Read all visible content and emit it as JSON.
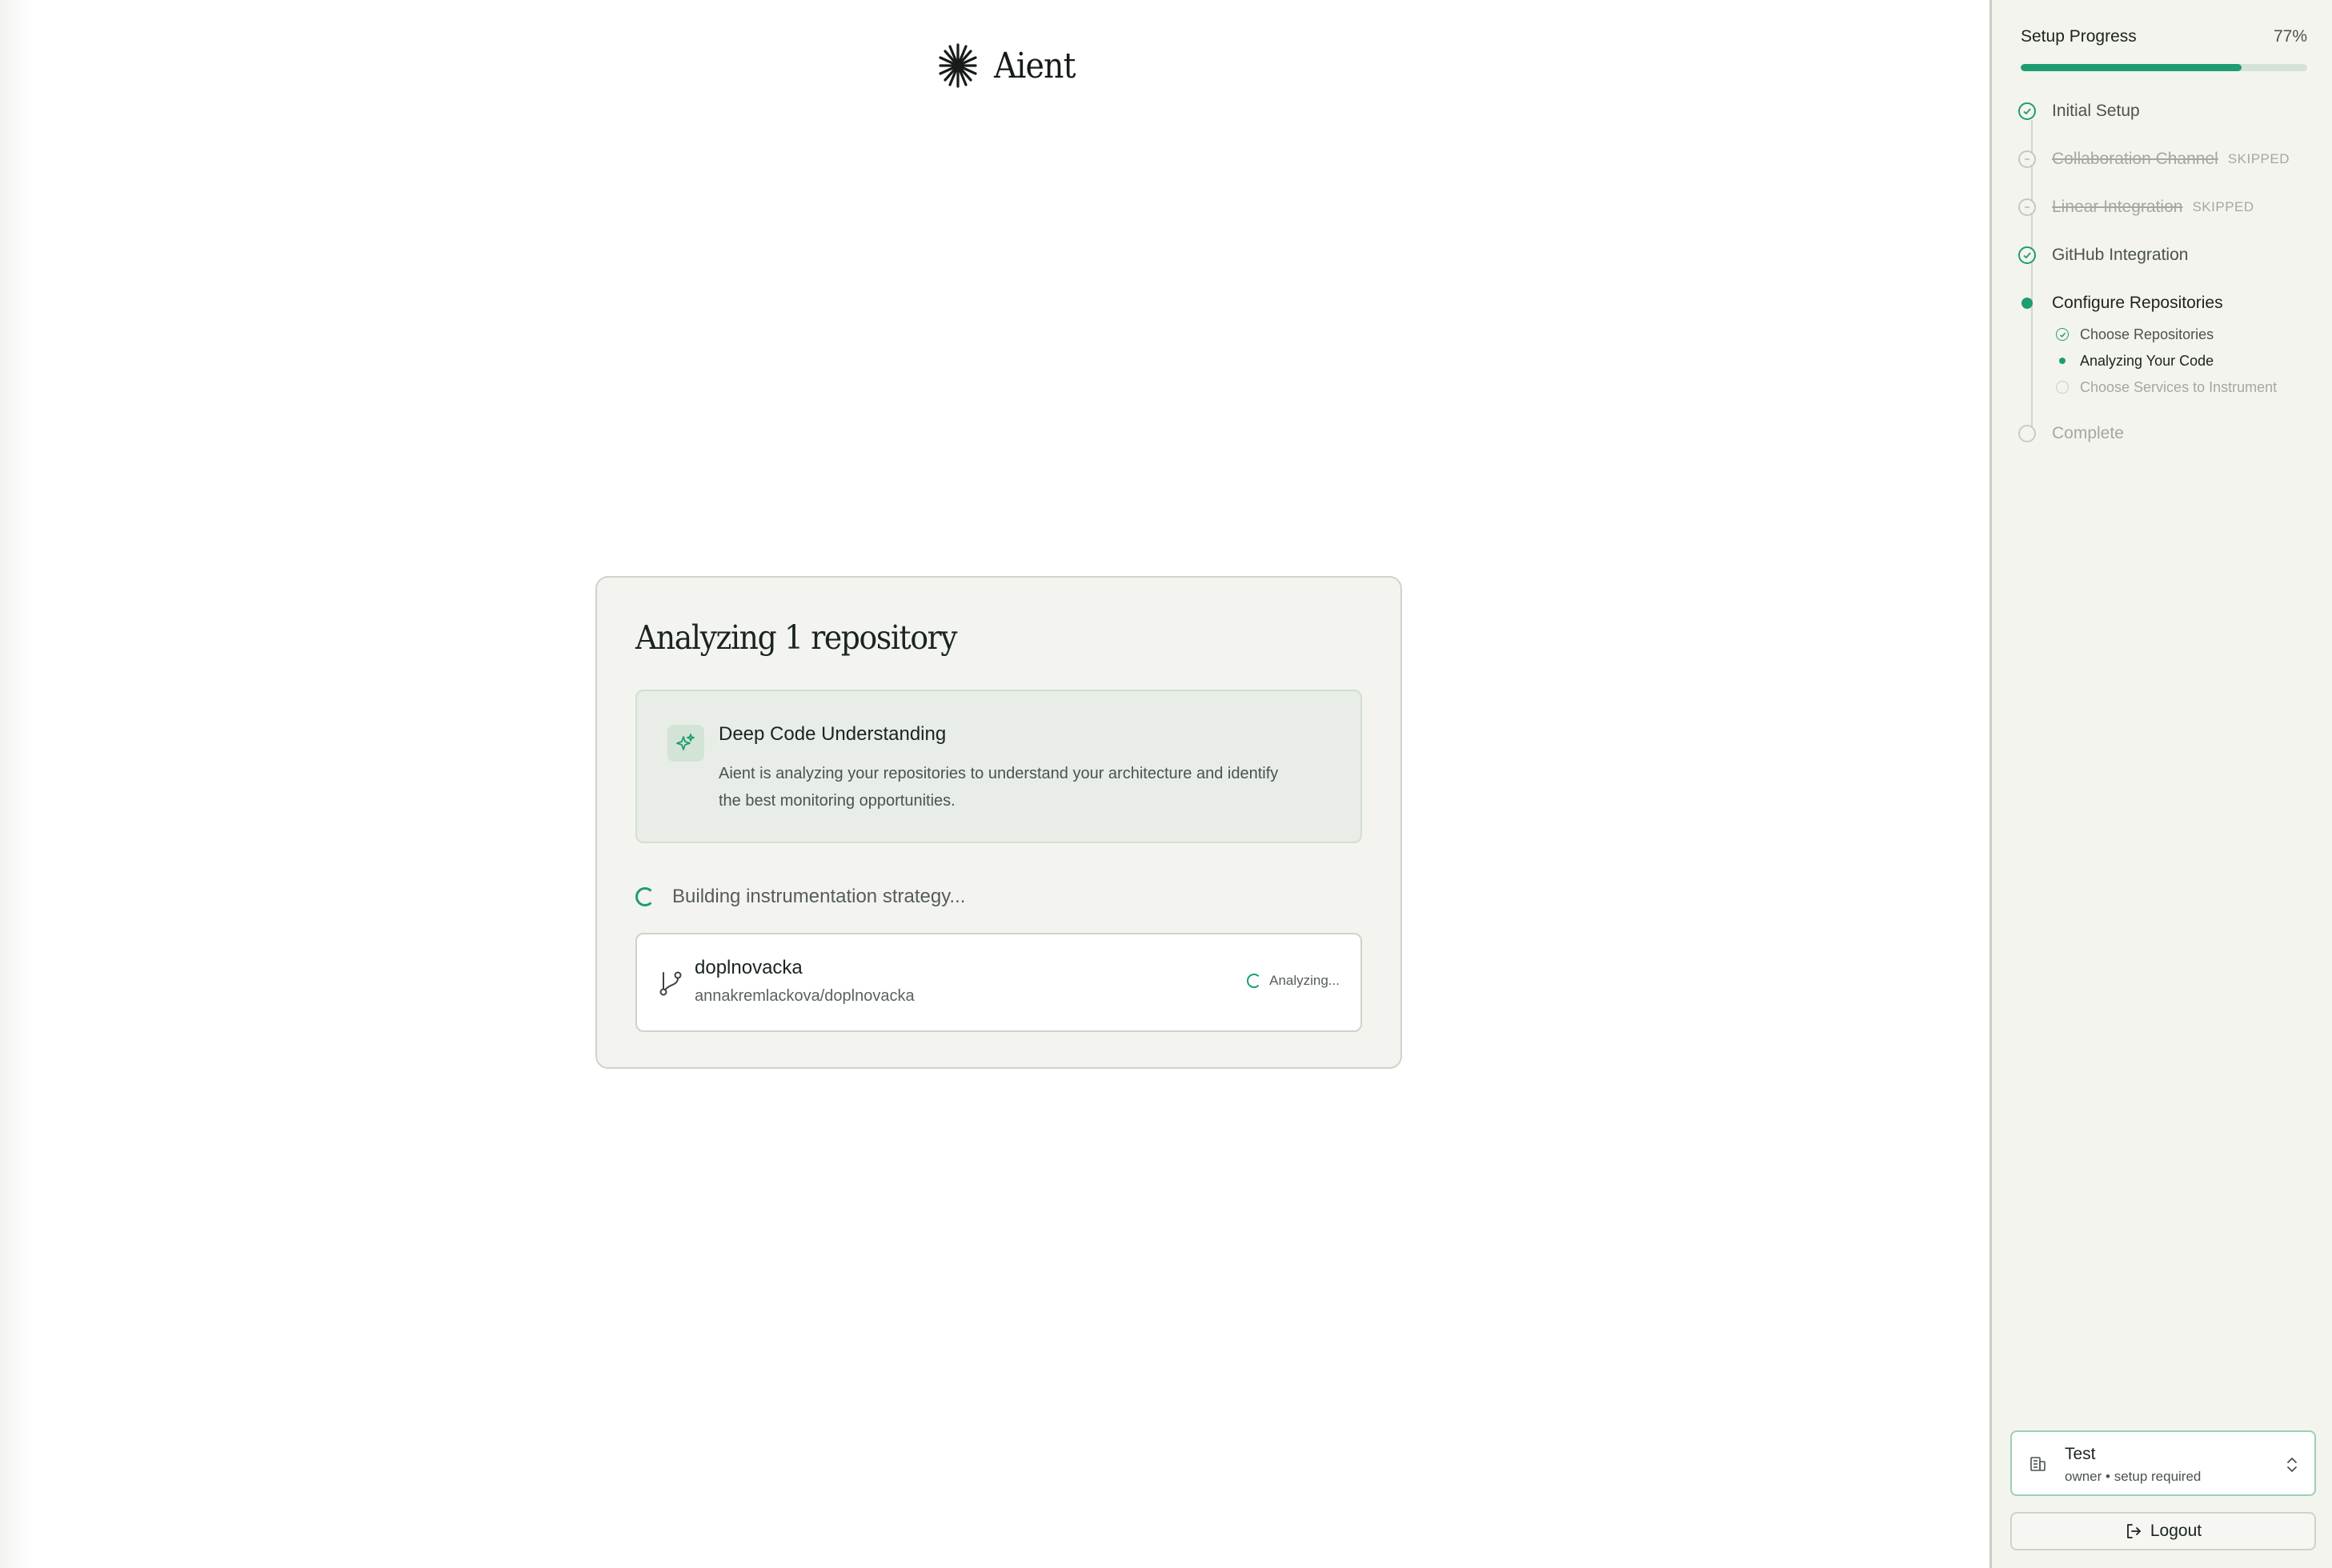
{
  "brand": {
    "name": "Aient",
    "icon": "asterisk-logo-icon"
  },
  "card": {
    "title": "Analyzing 1 repository",
    "info": {
      "icon": "sparkles-icon",
      "title": "Deep Code Understanding",
      "description": "Aient is analyzing your repositories to understand your architecture and identify the best monitoring opportunities."
    },
    "status_text": "Building instrumentation strategy...",
    "repo": {
      "icon": "git-branch-icon",
      "name": "doplnovacka",
      "full_name": "annakremlackova/doplnovacka",
      "status": "Analyzing..."
    }
  },
  "sidebar": {
    "title": "Setup Progress",
    "percent_label": "77%",
    "progress": 0.77,
    "steps": [
      {
        "label": "Initial Setup",
        "state": "done"
      },
      {
        "label": "Collaboration Channel",
        "state": "skipped",
        "tag": "SKIPPED"
      },
      {
        "label": "Linear Integration",
        "state": "skipped",
        "tag": "SKIPPED"
      },
      {
        "label": "GitHub Integration",
        "state": "done"
      },
      {
        "label": "Configure Repositories",
        "state": "current"
      },
      {
        "label": "Complete",
        "state": "pending"
      }
    ],
    "substeps": [
      {
        "label": "Choose Repositories",
        "state": "done"
      },
      {
        "label": "Analyzing Your Code",
        "state": "current"
      },
      {
        "label": "Choose Services to Instrument",
        "state": "pending"
      }
    ],
    "org": {
      "icon": "building-icon",
      "name": "Test",
      "subtitle": "owner • setup required"
    },
    "logout_label": "Logout"
  },
  "colors": {
    "accent": "#1e9d72",
    "card_bg": "#f3f4ef",
    "sidebar_bg": "#f4f4ef"
  }
}
